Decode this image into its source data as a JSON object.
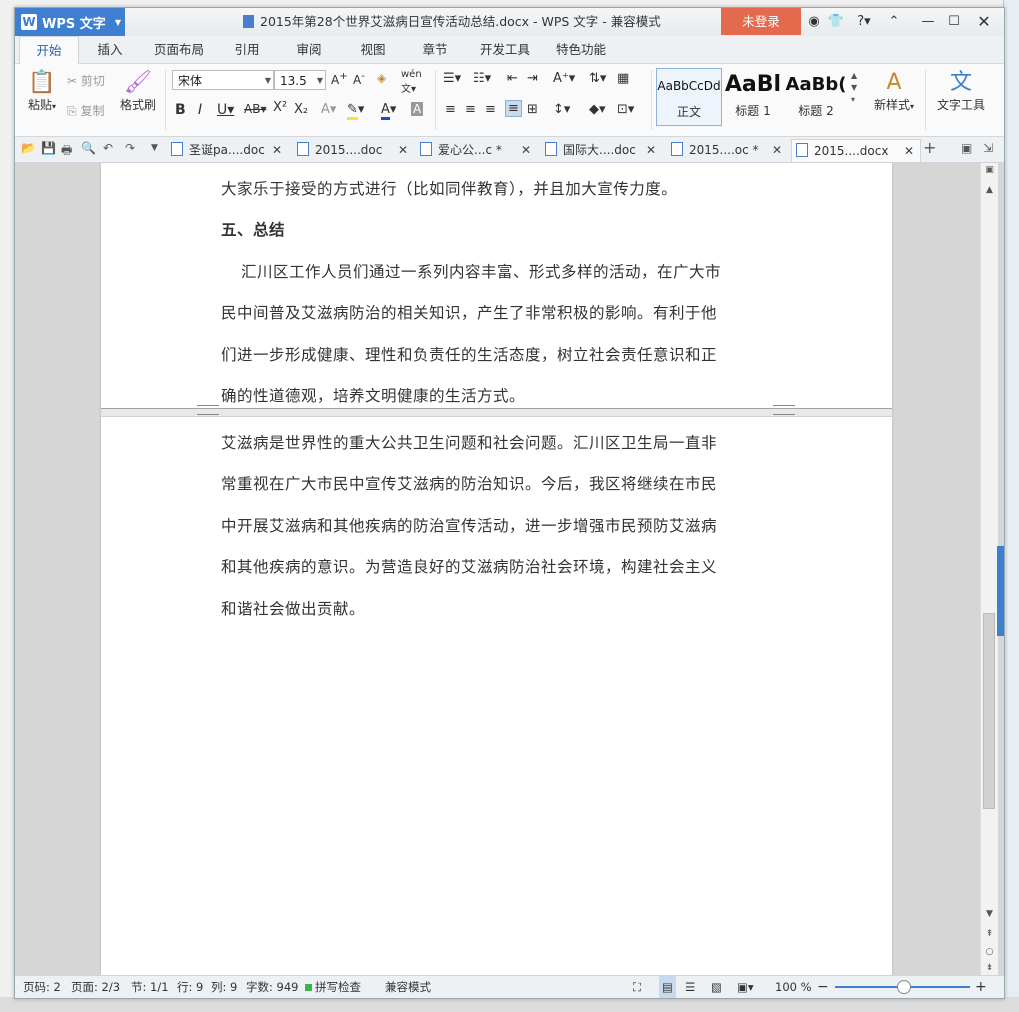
{
  "window": {
    "app_name": "WPS 文字",
    "title": "2015年第28个世界艾滋病日宣传活动总结.docx - WPS 文字 - 兼容模式",
    "login_label": "未登录"
  },
  "ribbon_tabs": [
    "开始",
    "插入",
    "页面布局",
    "引用",
    "审阅",
    "视图",
    "章节",
    "开发工具",
    "特色功能"
  ],
  "ribbon": {
    "paste": "粘贴",
    "cut": "剪切",
    "copy": "复制",
    "format_painter": "格式刷",
    "font_name": "宋体",
    "font_size": "13.5",
    "styles": [
      {
        "preview": "AaBbCcDd",
        "label": "正文"
      },
      {
        "preview": "AaBl",
        "label": "标题 1"
      },
      {
        "preview": "AaBb(",
        "label": "标题 2"
      }
    ],
    "new_style": "新样式",
    "text_tools": "文字工具"
  },
  "doc_tabs": [
    {
      "label": "圣诞pa....doc",
      "active": false
    },
    {
      "label": "2015....doc",
      "active": false
    },
    {
      "label": "爱心公...c *",
      "active": false
    },
    {
      "label": "国际大....doc",
      "active": false
    },
    {
      "label": "2015....oc *",
      "active": false
    },
    {
      "label": "2015....docx",
      "active": true
    }
  ],
  "document": {
    "page_top_lines": [
      "大家乐于接受的方式进行（比如同伴教育），并且加大宣传力度。",
      "五、总结",
      "汇川区工作人员们通过一系列内容丰富、形式多样的活动，在广大市",
      "民中间普及艾滋病防治的相关知识，产生了非常积极的影响。有利于他",
      "们进一步形成健康、理性和负责任的生活态度，树立社会责任意识和正",
      "确的性道德观，培养文明健康的生活方式。"
    ],
    "page_bottom_lines": [
      "艾滋病是世界性的重大公共卫生问题和社会问题。汇川区卫生局一直非",
      "常重视在广大市民中宣传艾滋病的防治知识。今后，我区将继续在市民",
      "中开展艾滋病和其他疾病的防治宣传活动，进一步增强市民预防艾滋病",
      "和其他疾病的意识。为营造良好的艾滋病防治社会环境，构建社会主义",
      "和谐社会做出贡献。"
    ]
  },
  "status": {
    "page_code": "页码: 2",
    "page": "页面: 2/3",
    "section": "节: 1/1",
    "row": "行: 9",
    "col": "列: 9",
    "word_count": "字数: 949",
    "spell_check": "拼写检查",
    "compat": "兼容模式",
    "zoom": "100 %"
  },
  "colors": {
    "accent": "#3f7fd1",
    "login": "#e36a4d"
  }
}
